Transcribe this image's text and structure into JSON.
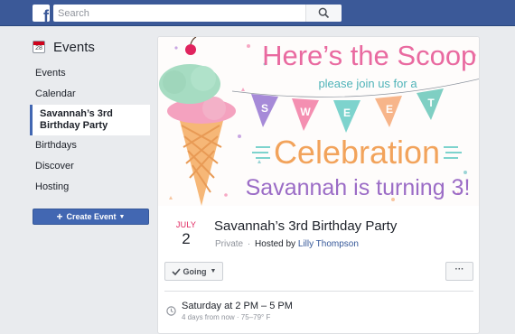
{
  "search": {
    "placeholder": "Search"
  },
  "sidebar": {
    "title": "Events",
    "calendar_day": "28",
    "items": [
      {
        "label": "Events"
      },
      {
        "label": "Calendar"
      },
      {
        "label": "Savannah’s 3rd Birthday Party"
      },
      {
        "label": "Birthdays"
      },
      {
        "label": "Discover"
      },
      {
        "label": "Hosting"
      }
    ],
    "create_label": "Create Event"
  },
  "cover": {
    "line1": "Here’s the Scoop!",
    "line2": "please join us for a",
    "banner_letters": [
      "S",
      "W",
      "E",
      "E",
      "T"
    ],
    "line3": "Celebration",
    "line4": "Savannah is turning 3!"
  },
  "event": {
    "month": "JULY",
    "day": "2",
    "title": "Savannah’s 3rd Birthday Party",
    "privacy": "Private",
    "separator": "·",
    "hosted_by": "Hosted by",
    "host_name": "Lilly Thompson",
    "going_label": "Going",
    "more_label": "···",
    "time": "Saturday at 2 PM – 5 PM",
    "time_detail": "4 days from now · 75–79° F"
  }
}
